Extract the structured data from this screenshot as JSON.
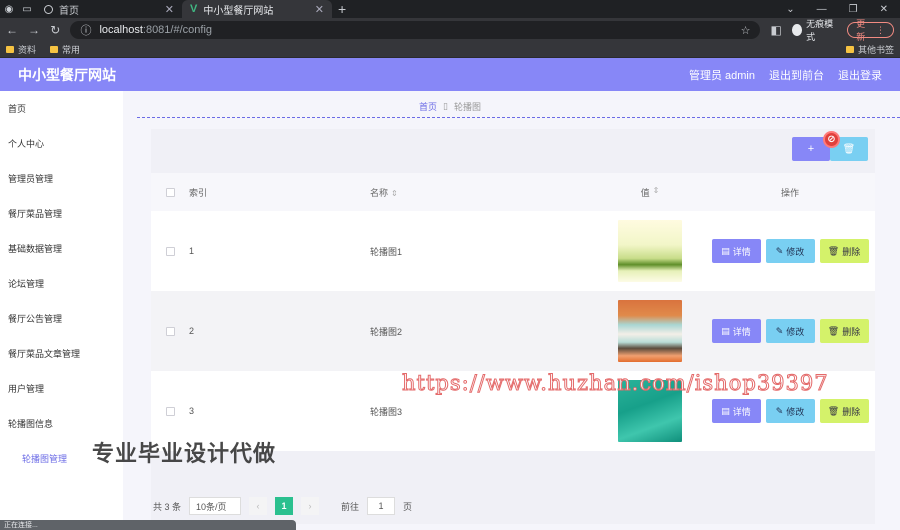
{
  "browser": {
    "tabs": [
      {
        "title": "首页",
        "active": false
      },
      {
        "title": "中小型餐厅网站",
        "active": true
      }
    ],
    "url": {
      "host": "localhost",
      "path": ":8081/#/config"
    },
    "profile_label": "无痕模式",
    "update_label": "更新",
    "bookmarks": [
      "资料",
      "常用"
    ],
    "other_bookmarks": "其他书签",
    "status_text": "正在连接..."
  },
  "header": {
    "title": "中小型餐厅网站",
    "admin": "管理员 admin",
    "exit_front": "退出到前台",
    "logout": "退出登录"
  },
  "sidebar": {
    "items": [
      {
        "label": "首页"
      },
      {
        "label": "个人中心"
      },
      {
        "label": "管理员管理"
      },
      {
        "label": "餐厅菜品管理"
      },
      {
        "label": "基础数据管理"
      },
      {
        "label": "论坛管理"
      },
      {
        "label": "餐厅公告管理"
      },
      {
        "label": "餐厅菜品文章管理"
      },
      {
        "label": "用户管理"
      },
      {
        "label": "轮播图信息"
      },
      {
        "label": "轮播图管理"
      }
    ]
  },
  "breadcrumb": {
    "home": "首页",
    "current": "轮播图"
  },
  "toolbar": {
    "add_label": "+",
    "delete_label": "🗑"
  },
  "table": {
    "headers": {
      "index": "索引",
      "name": "名称",
      "value": "值",
      "ops": "操作"
    },
    "rows": [
      {
        "index": "1",
        "name": "轮播图1"
      },
      {
        "index": "2",
        "name": "轮播图2"
      },
      {
        "index": "3",
        "name": "轮播图3"
      }
    ],
    "ops": {
      "detail": "详情",
      "edit": "修改",
      "remove": "删除"
    }
  },
  "pagination": {
    "total": "共 3 条",
    "page_size": "10条/页",
    "current_page": "1",
    "goto": "前往",
    "goto_value": "1",
    "page_unit": "页"
  },
  "watermarks": {
    "url": "https://www.huzhan.com/ishop39397",
    "cn": "专业毕业设计代做"
  },
  "colors": {
    "header": "#8787f7",
    "edit": "#79cff2",
    "remove": "#d4f26a",
    "pager_active": "#2bc08f"
  }
}
